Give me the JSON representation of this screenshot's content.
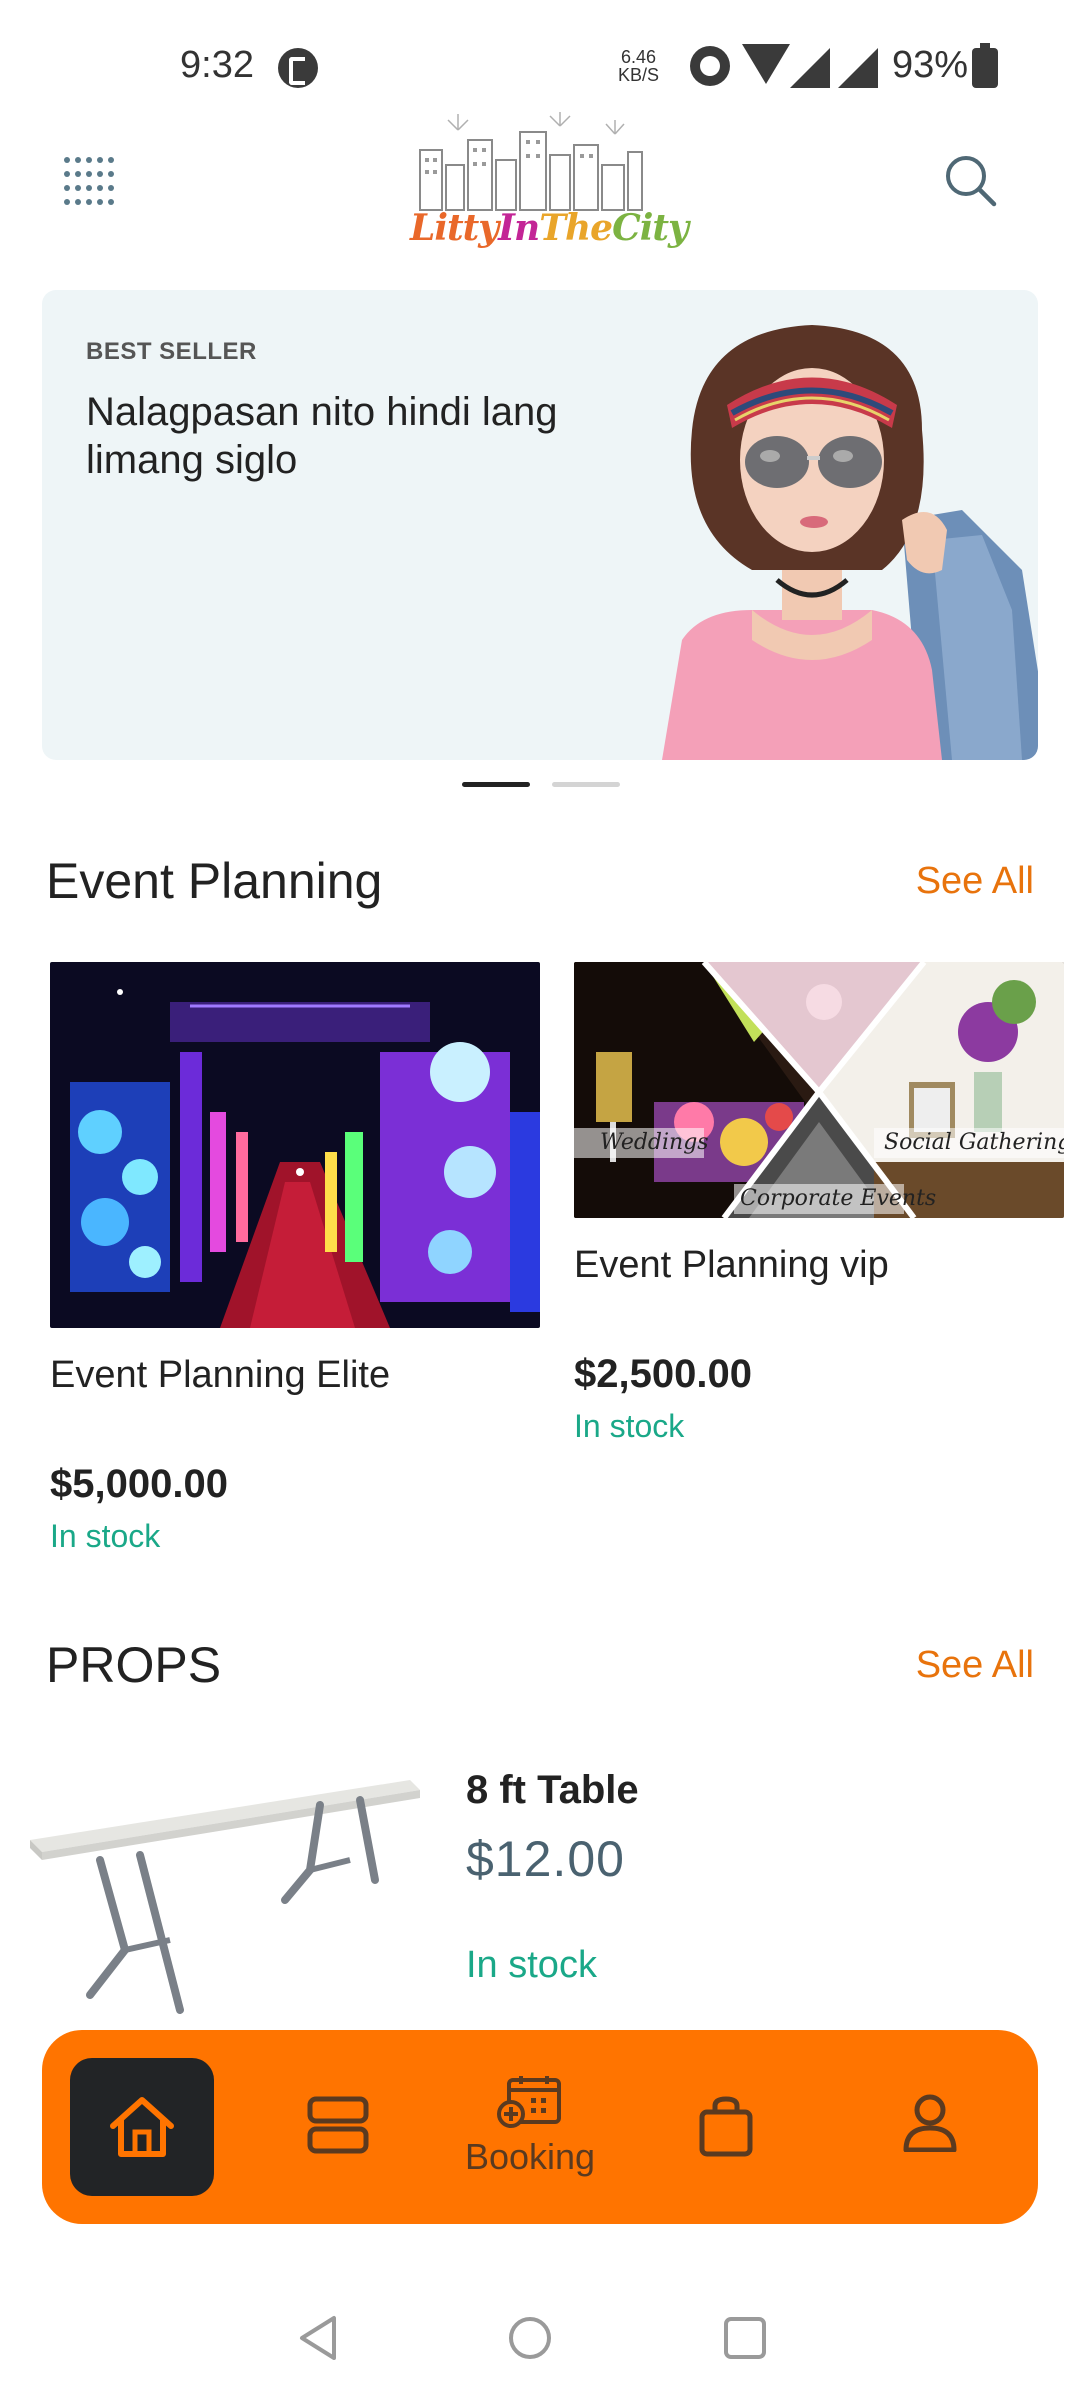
{
  "status_bar": {
    "time": "9:32",
    "net_speed_value": "6.46",
    "net_speed_unit": "KB/S",
    "battery": "93%"
  },
  "header": {
    "logo_text_1": "Litty",
    "logo_text_2": "In",
    "logo_text_3": "The",
    "logo_text_4": "City"
  },
  "banner": {
    "tag": "BEST SELLER",
    "title": "Nalagpasan nito hindi lang limang siglo",
    "page_count": 2,
    "active_page": 1
  },
  "event_planning": {
    "title": "Event Planning",
    "see_all": "See All",
    "products": [
      {
        "name": "Event Planning Elite",
        "price": "$5,000.00",
        "stock": "In stock"
      },
      {
        "name": "Event Planning vip",
        "price": "$2,500.00",
        "stock": "In stock",
        "image_captions": [
          "Weddings",
          "Social Gatherings",
          "Corporate Events"
        ]
      }
    ]
  },
  "props": {
    "title": "PROPS",
    "see_all": "See All",
    "products": [
      {
        "name": "8 ft Table",
        "price": "$12.00",
        "stock": "In stock"
      }
    ]
  },
  "bottom_nav": {
    "items": [
      {
        "icon": "home-icon",
        "active": true
      },
      {
        "icon": "categories-icon"
      },
      {
        "icon": "calendar-add-icon",
        "label": "Booking"
      },
      {
        "icon": "shopping-bag-icon"
      },
      {
        "icon": "profile-icon"
      }
    ]
  },
  "colors": {
    "accent": "#ff7400",
    "see_all": "#e8730c",
    "in_stock": "#1aa888",
    "banner_bg": "#eef5f7",
    "nav_active_bg": "#222426"
  }
}
